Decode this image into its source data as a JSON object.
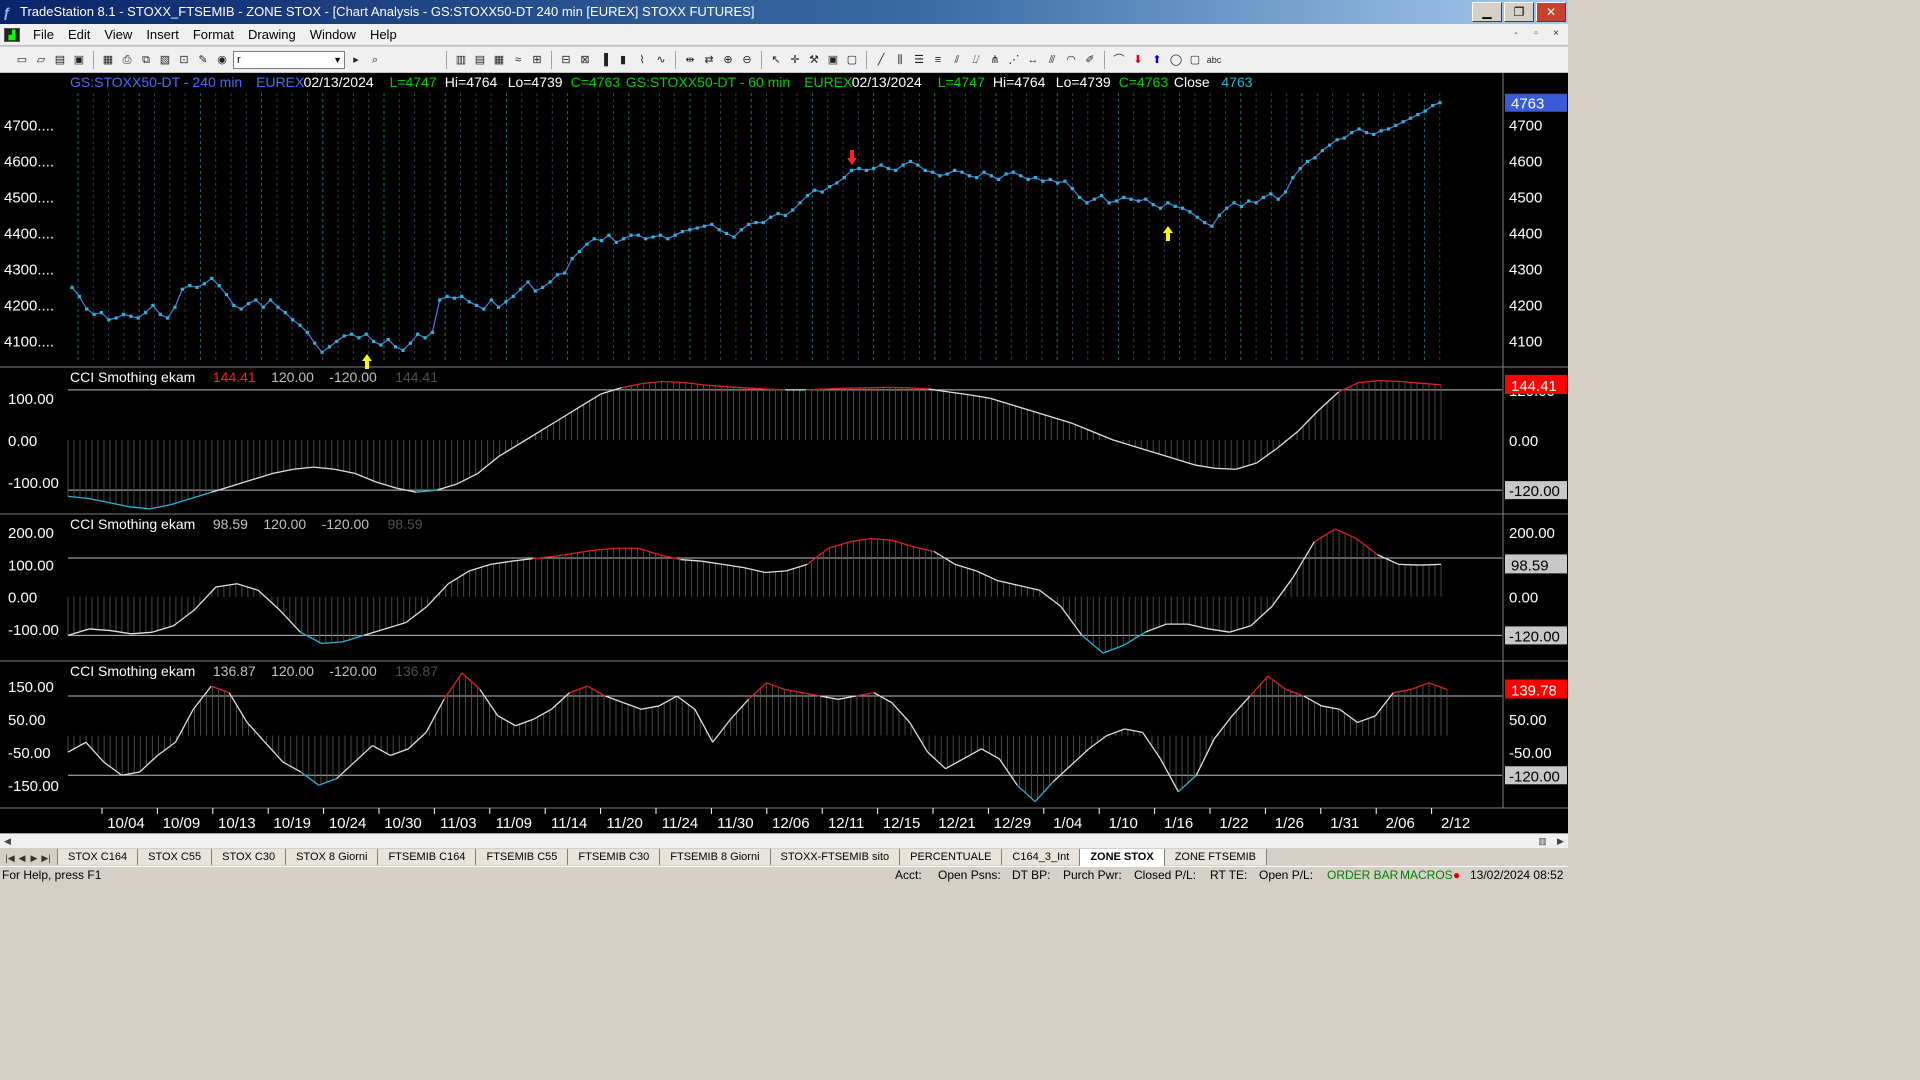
{
  "window": {
    "title": "TradeStation 8.1 - STOXX_FTSEMIB - ZONE STOX - [Chart Analysis - GS:STOXX50-DT  240 min  [EUREX] STOXX FUTURES]",
    "app_icon": "tradestation-icon",
    "controls": [
      "minimize",
      "maximize",
      "close"
    ]
  },
  "menu": {
    "items": [
      "File",
      "Edit",
      "View",
      "Insert",
      "Format",
      "Drawing",
      "Window",
      "Help"
    ],
    "mdi_controls": [
      "-",
      "▫",
      "×"
    ]
  },
  "toolbar": {
    "combo_value": "r"
  },
  "chart": {
    "price_header": [
      {
        "text": "GS:STOXX50-DT - 240 min",
        "color": "#4a6cff"
      },
      {
        "text": "EUREX",
        "color": "#4a6cff"
      },
      {
        "text": "02/13/2024",
        "color": "#ffffff"
      },
      {
        "text": "L=4747",
        "color": "#00d000"
      },
      {
        "text": "Hi=4764",
        "color": "#ffffff"
      },
      {
        "text": "Lo=4739",
        "color": "#ffffff"
      },
      {
        "text": "C=4763",
        "color": "#00d000"
      },
      {
        "text": "GS:STOXX50-DT - 60 min",
        "color": "#00d000"
      },
      {
        "text": "EUREX",
        "color": "#00d000"
      },
      {
        "text": "02/13/2024",
        "color": "#ffffff"
      },
      {
        "text": "L=4747",
        "color": "#00d000"
      },
      {
        "text": "Hi=4764",
        "color": "#ffffff"
      },
      {
        "text": "Lo=4739",
        "color": "#ffffff"
      },
      {
        "text": "C=4763",
        "color": "#00d000"
      },
      {
        "text": "Close",
        "color": "#ffffff"
      },
      {
        "text": "4763",
        "color": "#29b6d6"
      }
    ],
    "price_left_ticks": [
      "4700....",
      "4600....",
      "4500....",
      "4400....",
      "4300....",
      "4200....",
      "4100...."
    ],
    "price_right_ticks": [
      "4700",
      "4600",
      "4500",
      "4400",
      "4300",
      "4200",
      "4100"
    ],
    "price_last_label": "4763",
    "x_dates": [
      "10/04",
      "10/09",
      "10/13",
      "10/19",
      "10/24",
      "10/30",
      "11/03",
      "11/09",
      "11/14",
      "11/20",
      "11/24",
      "11/30",
      "12/06",
      "12/11",
      "12/15",
      "12/21",
      "12/29",
      "1/04",
      "1/10",
      "1/16",
      "1/22",
      "1/26",
      "1/31",
      "2/06",
      "2/12"
    ],
    "cci_panels": [
      {
        "header": [
          {
            "text": "CCI Smothing ekam",
            "color": "#ffffff"
          },
          {
            "text": "144.41",
            "color": "#ff2020"
          },
          {
            "text": "120.00",
            "color": "#c0c0c0"
          },
          {
            "text": "-120.00",
            "color": "#c0c0c0"
          },
          {
            "text": "144.41",
            "color": "#505050"
          }
        ],
        "left_ticks": [
          "100.00",
          "0.00",
          "-100.00"
        ],
        "right_ticks": [
          "120.00",
          "0.00"
        ],
        "last_label": "144.41",
        "lower_label": "-120.00"
      },
      {
        "header": [
          {
            "text": "CCI Smothing ekam",
            "color": "#ffffff"
          },
          {
            "text": "98.59",
            "color": "#c0c0c0"
          },
          {
            "text": "120.00",
            "color": "#c0c0c0"
          },
          {
            "text": "-120.00",
            "color": "#c0c0c0"
          },
          {
            "text": "98.59",
            "color": "#505050"
          }
        ],
        "left_ticks": [
          "200.00",
          "100.00",
          "0.00",
          "-100.00"
        ],
        "right_ticks": [
          "200.00",
          "100.00",
          "0.00"
        ],
        "last_label": "98.59",
        "lower_label": "-120.00"
      },
      {
        "header": [
          {
            "text": "CCI Smothing ekam",
            "color": "#ffffff"
          },
          {
            "text": "136.87",
            "color": "#c0c0c0"
          },
          {
            "text": "120.00",
            "color": "#c0c0c0"
          },
          {
            "text": "-120.00",
            "color": "#c0c0c0"
          },
          {
            "text": "136.87",
            "color": "#505050"
          }
        ],
        "left_ticks": [
          "150.00",
          "50.00",
          "-50.00",
          "-150.00"
        ],
        "right_ticks": [
          "50.00",
          "-50.00"
        ],
        "last_label": "139.78",
        "lower_label": "-120.00"
      }
    ]
  },
  "chart_data": {
    "type": "line",
    "series": [
      {
        "name": "GS:STOXX50-DT - 240 min",
        "values": [
          4250,
          4225,
          4190,
          4175,
          4180,
          4160,
          4165,
          4175,
          4170,
          4165,
          4180,
          4200,
          4175,
          4165,
          4195,
          4245,
          4255,
          4250,
          4260,
          4275,
          4255,
          4230,
          4200,
          4190,
          4205,
          4215,
          4195,
          4215,
          4195,
          4180,
          4160,
          4145,
          4125,
          4095,
          4070,
          4085,
          4100,
          4115,
          4120,
          4110,
          4120,
          4100,
          4090,
          4105,
          4085,
          4075,
          4095,
          4120,
          4110,
          4125,
          4215,
          4225,
          4220,
          4225,
          4210,
          4200,
          4190,
          4215,
          4195,
          4210,
          4225,
          4245,
          4265,
          4240,
          4250,
          4265,
          4285,
          4290,
          4330,
          4350,
          4370,
          4385,
          4380,
          4395,
          4375,
          4385,
          4395,
          4395,
          4385,
          4390,
          4395,
          4385,
          4395,
          4405,
          4410,
          4415,
          4420,
          4425,
          4410,
          4400,
          4390,
          4410,
          4425,
          4430,
          4430,
          4445,
          4455,
          4450,
          4465,
          4485,
          4505,
          4520,
          4515,
          4530,
          4540,
          4555,
          4575,
          4580,
          4575,
          4580,
          4590,
          4580,
          4575,
          4590,
          4600,
          4590,
          4575,
          4570,
          4560,
          4565,
          4575,
          4570,
          4560,
          4555,
          4570,
          4560,
          4550,
          4565,
          4570,
          4560,
          4550,
          4555,
          4545,
          4550,
          4540,
          4545,
          4525,
          4500,
          4485,
          4495,
          4505,
          4485,
          4490,
          4500,
          4495,
          4490,
          4495,
          4480,
          4470,
          4485,
          4475,
          4470,
          4460,
          4445,
          4430,
          4420,
          4450,
          4470,
          4485,
          4475,
          4490,
          4485,
          4500,
          4510,
          4495,
          4515,
          4555,
          4580,
          4600,
          4610,
          4630,
          4645,
          4660,
          4665,
          4680,
          4690,
          4680,
          4675,
          4685,
          4690,
          4700,
          4710,
          4720,
          4730,
          4740,
          4755,
          4763
        ]
      },
      {
        "name": "CCI Smothing ekam",
        "values": [
          -135,
          -140,
          -150,
          -160,
          -165,
          -155,
          -140,
          -125,
          -110,
          -95,
          -80,
          -70,
          -65,
          -70,
          -80,
          -100,
          -115,
          -125,
          -120,
          -105,
          -80,
          -40,
          -10,
          20,
          50,
          80,
          110,
          125,
          135,
          140,
          138,
          132,
          128,
          125,
          122,
          120,
          120,
          122,
          124,
          125,
          126,
          125,
          122,
          115,
          108,
          100,
          85,
          70,
          55,
          40,
          20,
          0,
          -15,
          -30,
          -45,
          -60,
          -68,
          -70,
          -55,
          -20,
          20,
          70,
          115,
          138,
          142,
          140,
          136,
          132
        ]
      },
      {
        "name": "CCI Smothing ekam",
        "values": [
          -120,
          -100,
          -105,
          -115,
          -110,
          -90,
          -40,
          30,
          40,
          20,
          -40,
          -110,
          -145,
          -140,
          -120,
          -100,
          -80,
          -30,
          40,
          80,
          100,
          110,
          118,
          125,
          135,
          145,
          150,
          150,
          130,
          115,
          110,
          100,
          90,
          75,
          80,
          100,
          150,
          170,
          180,
          175,
          155,
          140,
          100,
          80,
          50,
          35,
          20,
          -30,
          -120,
          -175,
          -150,
          -110,
          -85,
          -85,
          -100,
          -110,
          -90,
          -30,
          60,
          170,
          210,
          180,
          130,
          100,
          98,
          100
        ]
      },
      {
        "name": "CCI Smothing ekam",
        "values": [
          -50,
          -20,
          -80,
          -120,
          -110,
          -60,
          -20,
          80,
          150,
          130,
          40,
          -20,
          -80,
          -110,
          -150,
          -130,
          -80,
          -30,
          -60,
          -40,
          10,
          110,
          190,
          140,
          60,
          30,
          50,
          80,
          130,
          150,
          120,
          100,
          80,
          90,
          120,
          80,
          -20,
          50,
          110,
          160,
          140,
          130,
          120,
          110,
          120,
          130,
          100,
          40,
          -50,
          -100,
          -70,
          -40,
          -70,
          -150,
          -200,
          -140,
          -90,
          -40,
          0,
          20,
          10,
          -70,
          -170,
          -120,
          -10,
          60,
          120,
          180,
          140,
          120,
          90,
          80,
          40,
          60,
          130,
          140,
          160,
          139.78
        ]
      }
    ],
    "ylim": [
      4040,
      4790
    ],
    "y_ticks": [
      4100,
      4200,
      4300,
      4400,
      4500,
      4600,
      4700
    ],
    "cci_levels": [
      120,
      0,
      -120
    ],
    "arrows": [
      {
        "type": "up",
        "color": "#ffff00",
        "near_date": "10/26"
      },
      {
        "type": "down",
        "color": "#ff2020",
        "near_date": "12/11"
      },
      {
        "type": "up",
        "color": "#ffff00",
        "near_date": "1/16"
      }
    ]
  },
  "tabs": {
    "items": [
      "STOX C164",
      "STOX C55",
      "STOX  C30",
      "STOX  8 Giorni",
      "FTSEMIB C164",
      "FTSEMIB C55",
      "FTSEMIB C30",
      "FTSEMIB  8 Giorni",
      "STOXX-FTSEMIB sito",
      "PERCENTUALE",
      "C164_3_Int",
      "ZONE STOX",
      "ZONE FTSEMIB"
    ],
    "active": "ZONE STOX"
  },
  "status": {
    "help": "For Help, press F1",
    "acct": "Acct:",
    "open_psns": "Open Psns:",
    "dt_bp": "DT BP:",
    "purch_pwr": "Purch Pwr:",
    "closed_pl": "Closed P/L:",
    "rt_te": "RT TE:",
    "open_pl": "Open P/L:",
    "order_bar": "ORDER BAR",
    "macros": "MACROS",
    "datetime": "13/02/2024 08:52"
  },
  "colors": {
    "price_line": "#29b6d6",
    "cci_line": "#e0e0e0",
    "cci_high": "#e02020",
    "cci_low": "#29b6d6",
    "bg": "#000000",
    "last_label_bg": "#ff0000",
    "price_last_bg": "#3a5bd9"
  }
}
